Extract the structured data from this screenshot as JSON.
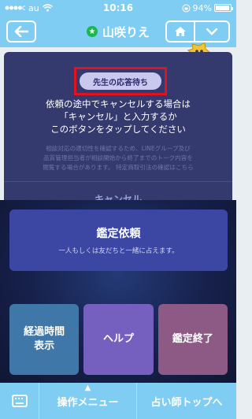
{
  "status": {
    "carrier": "au",
    "time": "10:16",
    "battery_text": "94%",
    "battery_level": 0.94
  },
  "header": {
    "title": "山咲りえ",
    "badge_glyph": "★"
  },
  "dialog": {
    "status_pill": "先生の応答待ち",
    "instruction_lines": [
      "依頼の途中でキャンセルする場合は",
      "「キャンセル」と入力するか",
      "このボタンをタップしてください"
    ],
    "notice_lines": [
      "相談対応の適切性を確認するため、LINEグループ及び",
      "品質管理担当者が相談開始から終了までのトーク内容を",
      "閲覧する場合があります。 特定商取引法の確認はこちら"
    ],
    "cancel_label": "キャンセル"
  },
  "panel": {
    "kantei_label": "鑑定依頼",
    "kantei_sub": "一人もしくは友だちと一緒に占えます。",
    "elapsed_line1": "経過時間",
    "elapsed_line2": "表示",
    "help_label": "ヘルプ",
    "end_label": "鑑定終了"
  },
  "bottom": {
    "menu_label": "操作メニュー",
    "menu_caret": "▲",
    "top_label": "占い師トップへ"
  },
  "colors": {
    "nav_bg": "#7fcdf3",
    "card_bg": "#353a6e",
    "highlight": "#e3121f"
  }
}
